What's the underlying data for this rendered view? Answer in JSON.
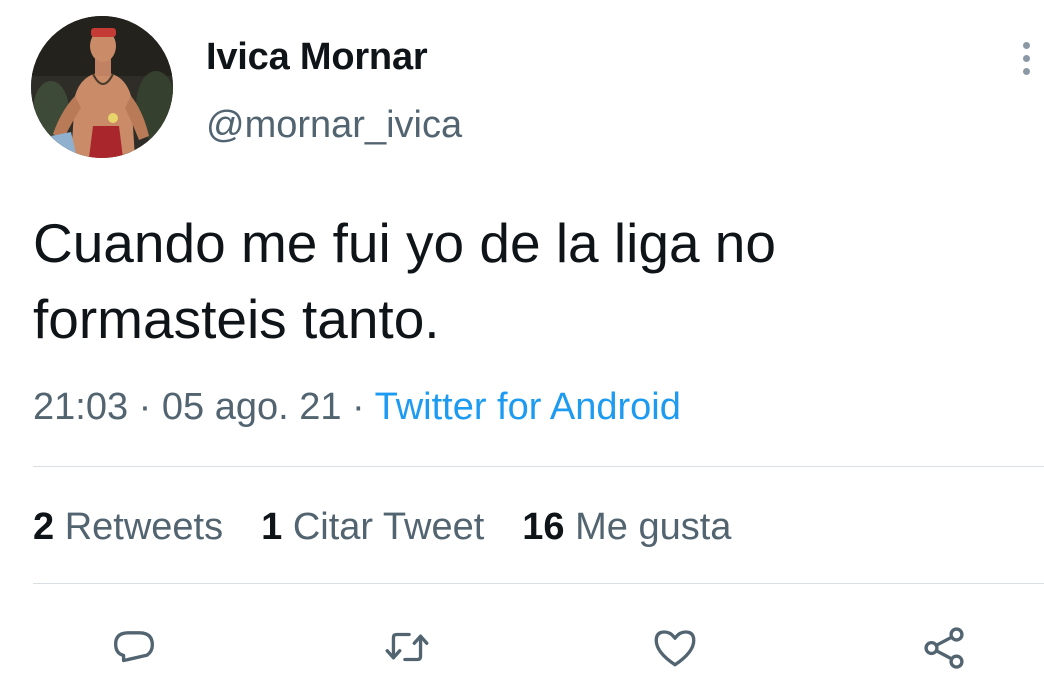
{
  "tweet": {
    "author": {
      "display_name": "Ivica Mornar",
      "handle": "@mornar_ivica",
      "avatar_icon": "profile-photo"
    },
    "text": "Cuando me fui yo de la liga no formasteis tanto.",
    "timestamp": {
      "time": "21:03",
      "date": "05 ago. 21",
      "separator": " · ",
      "source": "Twitter for Android"
    },
    "stats": {
      "retweets": {
        "count": "2",
        "label": "Retweets"
      },
      "quotes": {
        "count": "1",
        "label": "Citar Tweet"
      },
      "likes": {
        "count": "16",
        "label": "Me gusta"
      }
    },
    "actions": [
      {
        "icon": "reply-icon"
      },
      {
        "icon": "retweet-icon"
      },
      {
        "icon": "like-icon"
      },
      {
        "icon": "share-icon"
      }
    ]
  },
  "colors": {
    "text_primary": "#0f1419",
    "text_secondary": "#536471",
    "link": "#1d9bf0",
    "divider": "#d9dee2",
    "icon": "#536471"
  }
}
